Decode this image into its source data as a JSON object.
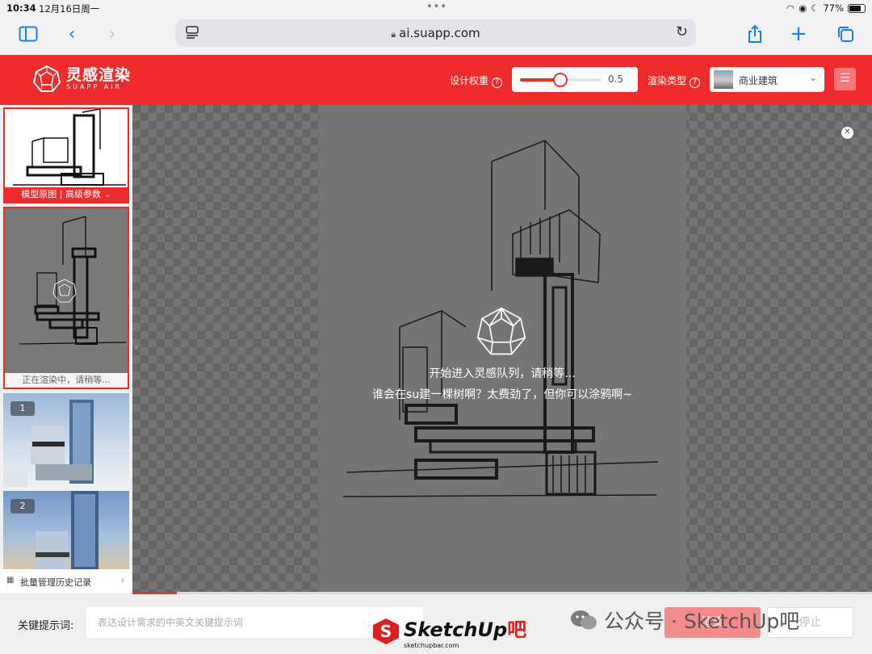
{
  "status_bar": {
    "time": "10:34",
    "date": "12月16日周一",
    "battery": "77%"
  },
  "browser": {
    "url": "ai.suapp.com"
  },
  "header": {
    "brand": "灵感渲染",
    "brand_sub": "SUAPP AIR",
    "weight_label": "设计权重",
    "weight_value": "0.5",
    "weight_fraction": 0.5,
    "render_type_label": "渲染类型",
    "render_type_value": "商业建筑"
  },
  "sidebar": {
    "card1_caption": "模型原图 | 高级参数",
    "card2_caption": "正在渲染中，请稍等...",
    "results": [
      "1",
      "2"
    ],
    "history_label": "批量管理历史记录"
  },
  "stage": {
    "line1": "开始进入灵感队列，请稍等...",
    "line2": "谁会在su建一棵树啊？太费劲了，但你可以涂鸦啊~",
    "progress": 0.06
  },
  "bottom": {
    "keyword_label": "关键提示词:",
    "keyword_placeholder": "表达设计需求的中英文关键提示词",
    "render_button": "渲染",
    "stop_button": "停止"
  },
  "watermarks": {
    "sketchup": "SketchUp",
    "sketchup_ba": "吧",
    "sketchup_url": "sketchupbar.com",
    "wechat": "公众号 · SketchUp吧"
  },
  "colors": {
    "brand_red": "#ef2b2b",
    "ios_blue": "#1a7cf5"
  }
}
